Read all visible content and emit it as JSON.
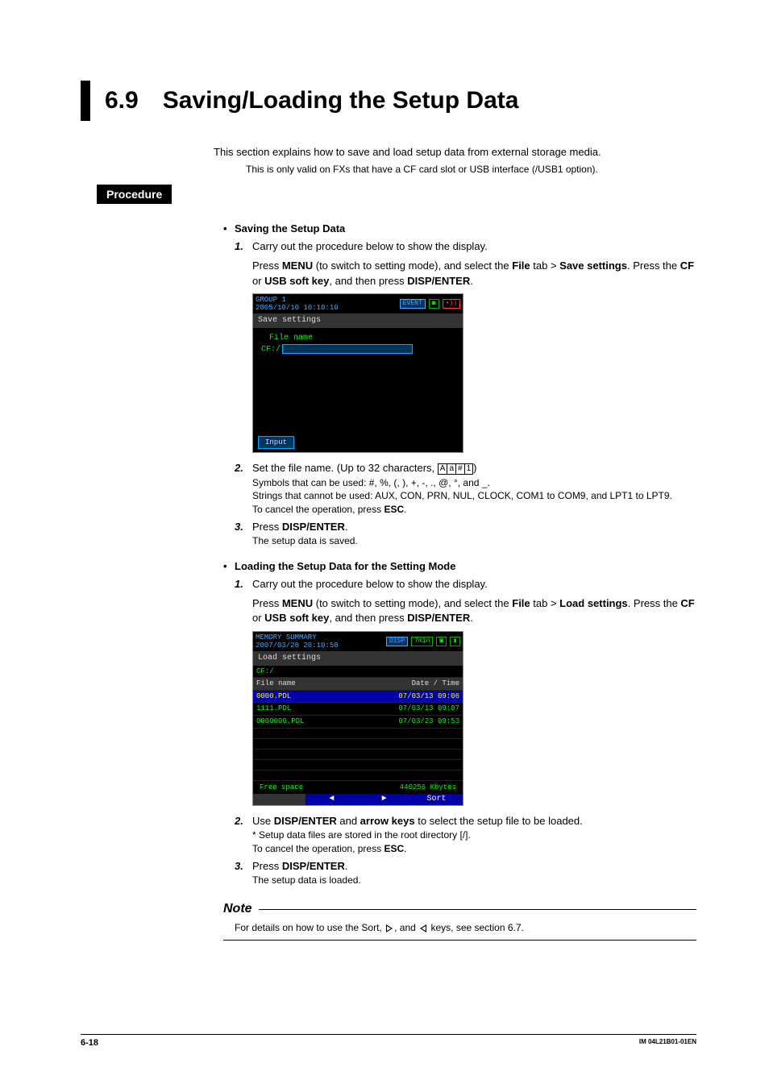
{
  "heading": {
    "num": "6.9",
    "title": "Saving/Loading the Setup Data"
  },
  "intro": "This section explains how to save and load setup data from external storage media.",
  "subintro": "This is only valid on FXs that have a CF card slot or USB interface (/USB1 option).",
  "procedure_label": "Procedure",
  "saving": {
    "title": "Saving the Setup Data",
    "step1": "Carry out the procedure below to show the display.",
    "step1_detail_a": "Press ",
    "step1_menu": "MENU",
    "step1_detail_b": " (to switch to setting mode), and select the ",
    "step1_file": "File",
    "step1_detail_c": " tab > ",
    "step1_save": "Save settings",
    "step1_detail_d": ". Press the ",
    "step1_cf": "CF",
    "step1_or": " or ",
    "step1_usb": "USB soft key",
    "step1_detail_e": ", and then press ",
    "step1_disp": "DISP/ENTER",
    "step1_detail_f": ".",
    "ss": {
      "group": "GROUP 1",
      "datetime": "2005/10/10 10:10:10",
      "tag": "EVENT",
      "title": "Save settings",
      "label": "File name",
      "path": "CF:/",
      "btn": "Input"
    },
    "step2_a": "Set the file name. (Up to 32 characters, ",
    "step2_chars": [
      "A",
      "a",
      "#",
      "1"
    ],
    "step2_b": ")",
    "step2_sym": "Symbols that can be used: #, %, (, ), +, -, ., @, °, and _.",
    "step2_str": "Strings that cannot be used: AUX, CON, PRN, NUL, CLOCK, COM1 to COM9, and LPT1 to LPT9.",
    "step2_cancel_a": "To cancel the operation, press ",
    "step2_cancel_b": "ESC",
    "step2_cancel_c": ".",
    "step3_a": "Press ",
    "step3_b": "DISP/ENTER",
    "step3_c": ".",
    "step3_note": "The setup data is saved."
  },
  "loading": {
    "title": "Loading the Setup Data for the Setting Mode",
    "step1": "Carry out the procedure below to show the display.",
    "step1_detail_a": "Press ",
    "step1_menu": "MENU",
    "step1_detail_b": " (to switch to setting mode), and select the ",
    "step1_file": "File",
    "step1_detail_c": " tab > ",
    "step1_load": "Load settings",
    "step1_detail_d": ". Press the ",
    "step1_cf": "CF",
    "step1_or": " or ",
    "step1_usb": "USB soft key",
    "step1_detail_e": ", and then press ",
    "step1_disp": "DISP/ENTER",
    "step1_detail_f": ".",
    "ss": {
      "group": "MEMORY SUMMARY",
      "datetime": "2007/03/28 20:10:58",
      "tag": "DISP",
      "tag2": "7min",
      "title": "Load settings",
      "path": "CF:/",
      "col1": "File name",
      "col2": "Date / Time",
      "rows": [
        {
          "name": "0000.PDL",
          "dt": "07/03/13 09:06"
        },
        {
          "name": "1111.PDL",
          "dt": "07/03/13 09:07"
        },
        {
          "name": "0000000.PDL",
          "dt": "07/03/23 09:53"
        }
      ],
      "free_label": "Free space",
      "free_val": "440256 Kbytes",
      "sort": "Sort"
    },
    "step2_a": "Use ",
    "step2_b": "DISP/ENTER",
    "step2_c": " and ",
    "step2_d": "arrow keys",
    "step2_e": " to select the setup file to be loaded.",
    "step2_note": "*   Setup data files are stored in the root directory [/].",
    "step2_cancel_a": "To cancel the operation, press ",
    "step2_cancel_b": "ESC",
    "step2_cancel_c": ".",
    "step3_a": "Press ",
    "step3_b": "DISP/ENTER",
    "step3_c": ".",
    "step3_note": "The setup data is loaded."
  },
  "note": {
    "title": "Note",
    "body_a": "For details on how to use the Sort, ",
    "body_b": ", and ",
    "body_c": " keys, see section 6.7."
  },
  "footer": {
    "page": "6-18",
    "doc": "IM 04L21B01-01EN"
  }
}
